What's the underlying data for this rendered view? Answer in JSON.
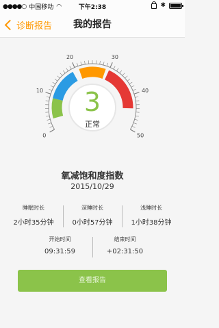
{
  "status_bar": {
    "carrier": "中国移动",
    "time": "下午2:38"
  },
  "nav": {
    "back_label": "诊断报告",
    "title": "我的报告"
  },
  "gauge": {
    "value_text": "3",
    "status_text": "正常",
    "scale_min": 0,
    "scale_max": 50,
    "value": 3,
    "tick_labels": [
      "0",
      "10",
      "20",
      "30",
      "40",
      "50"
    ],
    "colors": {
      "green": "#8bc34a",
      "blue": "#2b9be3",
      "orange": "#ff9800",
      "red": "#e53935",
      "value_text": "#8bc34a"
    }
  },
  "report": {
    "title": "氧减饱和度指数",
    "date": "2015/10/29"
  },
  "stats": [
    {
      "label": "睡眠时长",
      "value": "2小时35分钟"
    },
    {
      "label": "深睡时长",
      "value": "0小时57分钟"
    },
    {
      "label": "浅睡时长",
      "value": "1小时38分钟"
    }
  ],
  "times": [
    {
      "label": "开始时间",
      "value": "09:31:59"
    },
    {
      "label": "结束时间",
      "value": "+02:31:50"
    }
  ],
  "button": {
    "label": "查看报告"
  }
}
